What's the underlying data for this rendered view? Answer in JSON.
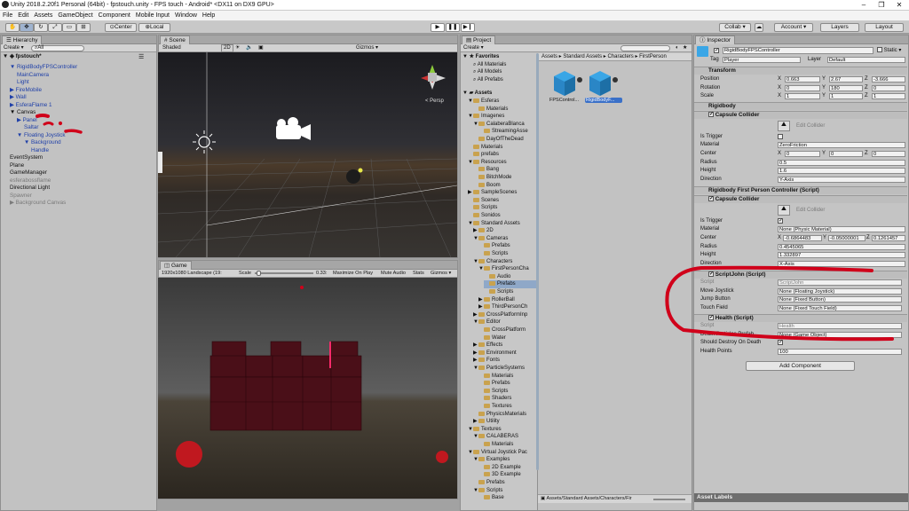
{
  "titlebar": {
    "title": "Unity 2018.2.20f1 Personal (64bit) - fpstouch.unity - FPS touch - Android* <DX11 on DX9 GPU>",
    "minimize": "–",
    "maximize": "❐",
    "close": "✕"
  },
  "menu": [
    "File",
    "Edit",
    "Assets",
    "GameObject",
    "Component",
    "Mobile Input",
    "Window",
    "Help"
  ],
  "toolbar": {
    "pivot": "Center",
    "space": "Local",
    "collab": "Collab ▾",
    "account": "Account ▾",
    "layers": "Layers",
    "layout": "Layout"
  },
  "hierarchy": {
    "tab": "Hierarchy",
    "create": "Create ▾",
    "search": "All",
    "scene": "fpstouch*",
    "items": [
      {
        "label": "RigidBodyFPSController",
        "indent": 1,
        "color": "blue",
        "arrow": "▼"
      },
      {
        "label": "MainCamera",
        "indent": 2,
        "color": "blue",
        "arrow": ""
      },
      {
        "label": "Light",
        "indent": 2,
        "color": "blue",
        "arrow": ""
      },
      {
        "label": "FireMobile",
        "indent": 1,
        "color": "blue",
        "arrow": "▶"
      },
      {
        "label": "Wall",
        "indent": 1,
        "color": "blue",
        "arrow": "▶"
      },
      {
        "label": "EsferaFlame 1",
        "indent": 1,
        "color": "blue",
        "arrow": "▶"
      },
      {
        "label": "Canvas",
        "indent": 1,
        "color": "black",
        "arrow": "▼"
      },
      {
        "label": "Panel",
        "indent": 2,
        "color": "blue",
        "arrow": "▶"
      },
      {
        "label": "Saltar",
        "indent": 3,
        "color": "blue",
        "arrow": ""
      },
      {
        "label": "Floating Joystick",
        "indent": 2,
        "color": "blue",
        "arrow": "▼"
      },
      {
        "label": "Background",
        "indent": 3,
        "color": "blue",
        "arrow": "▼"
      },
      {
        "label": "Handle",
        "indent": 4,
        "color": "blue",
        "arrow": ""
      },
      {
        "label": "EventSystem",
        "indent": 1,
        "color": "black",
        "arrow": ""
      },
      {
        "label": "Plane",
        "indent": 1,
        "color": "black",
        "arrow": ""
      },
      {
        "label": "GameManager",
        "indent": 1,
        "color": "black",
        "arrow": ""
      },
      {
        "label": "esferabossflame",
        "indent": 1,
        "color": "gray",
        "arrow": ""
      },
      {
        "label": "Directional Light",
        "indent": 1,
        "color": "black",
        "arrow": ""
      },
      {
        "label": "Spawner",
        "indent": 1,
        "color": "gray",
        "arrow": ""
      },
      {
        "label": "Background Canvas",
        "indent": 1,
        "color": "gray",
        "arrow": "▶"
      }
    ]
  },
  "scene": {
    "tab": "Scene",
    "shading": "Shaded",
    "mode2d": "2D",
    "gizmos": "Gizmos ▾",
    "persp": "< Persp"
  },
  "game": {
    "tab": "Game",
    "resolution": "1920x1080 Landscape (19:",
    "scale_label": "Scale",
    "scale_value": "0.33:",
    "maximize": "Maximize On Play",
    "mute": "Mute Audio",
    "stats": "Stats",
    "gizmos": "Gizmos ▾"
  },
  "project": {
    "tab": "Project",
    "create": "Create ▾",
    "breadcrumb": [
      "Assets",
      "Standard Assets",
      "Characters",
      "FirstPerson"
    ],
    "favorites": {
      "title": "Favorites",
      "items": [
        "All Materials",
        "All Models",
        "All Prefabs"
      ]
    },
    "assets_title": "Assets",
    "tree": [
      {
        "label": "Esferas",
        "indent": 1,
        "arrow": "▼"
      },
      {
        "label": "Materials",
        "indent": 2,
        "arrow": ""
      },
      {
        "label": "Imagenes",
        "indent": 1,
        "arrow": "▼"
      },
      {
        "label": "CalaberaBlanca",
        "indent": 2,
        "arrow": "▼"
      },
      {
        "label": "StreamingAsse",
        "indent": 3,
        "arrow": ""
      },
      {
        "label": "DayOfTheDead",
        "indent": 2,
        "arrow": ""
      },
      {
        "label": "Materials",
        "indent": 1,
        "arrow": ""
      },
      {
        "label": "prefabs",
        "indent": 1,
        "arrow": ""
      },
      {
        "label": "Resources",
        "indent": 1,
        "arrow": "▼"
      },
      {
        "label": "Bang",
        "indent": 2,
        "arrow": ""
      },
      {
        "label": "BitchMode",
        "indent": 2,
        "arrow": ""
      },
      {
        "label": "Boom",
        "indent": 2,
        "arrow": ""
      },
      {
        "label": "SampleScenes",
        "indent": 1,
        "arrow": "▶"
      },
      {
        "label": "Scenes",
        "indent": 1,
        "arrow": ""
      },
      {
        "label": "Scripts",
        "indent": 1,
        "arrow": ""
      },
      {
        "label": "Sonidos",
        "indent": 1,
        "arrow": ""
      },
      {
        "label": "Standard Assets",
        "indent": 1,
        "arrow": "▼"
      },
      {
        "label": "2D",
        "indent": 2,
        "arrow": "▶"
      },
      {
        "label": "Cameras",
        "indent": 2,
        "arrow": "▼"
      },
      {
        "label": "Prefabs",
        "indent": 3,
        "arrow": ""
      },
      {
        "label": "Scripts",
        "indent": 3,
        "arrow": ""
      },
      {
        "label": "Characters",
        "indent": 2,
        "arrow": "▼"
      },
      {
        "label": "FirstPersonCha",
        "indent": 3,
        "arrow": "▼"
      },
      {
        "label": "Audio",
        "indent": 4,
        "arrow": ""
      },
      {
        "label": "Prefabs",
        "indent": 4,
        "arrow": "",
        "selected": true
      },
      {
        "label": "Scripts",
        "indent": 4,
        "arrow": ""
      },
      {
        "label": "RollerBall",
        "indent": 3,
        "arrow": "▶"
      },
      {
        "label": "ThirdPersonCh",
        "indent": 3,
        "arrow": "▶"
      },
      {
        "label": "CrossPlatformInp",
        "indent": 2,
        "arrow": "▶"
      },
      {
        "label": "Editor",
        "indent": 2,
        "arrow": "▼"
      },
      {
        "label": "CrossPlatform",
        "indent": 3,
        "arrow": ""
      },
      {
        "label": "Water",
        "indent": 3,
        "arrow": ""
      },
      {
        "label": "Effects",
        "indent": 2,
        "arrow": "▶"
      },
      {
        "label": "Environment",
        "indent": 2,
        "arrow": "▶"
      },
      {
        "label": "Fonts",
        "indent": 2,
        "arrow": "▶"
      },
      {
        "label": "ParticleSystems",
        "indent": 2,
        "arrow": "▼"
      },
      {
        "label": "Materials",
        "indent": 3,
        "arrow": ""
      },
      {
        "label": "Prefabs",
        "indent": 3,
        "arrow": ""
      },
      {
        "label": "Scripts",
        "indent": 3,
        "arrow": ""
      },
      {
        "label": "Shaders",
        "indent": 3,
        "arrow": ""
      },
      {
        "label": "Textures",
        "indent": 3,
        "arrow": ""
      },
      {
        "label": "PhysicsMaterials",
        "indent": 2,
        "arrow": ""
      },
      {
        "label": "Utility",
        "indent": 2,
        "arrow": "▶"
      },
      {
        "label": "Textures",
        "indent": 1,
        "arrow": "▼"
      },
      {
        "label": "CALABERAS",
        "indent": 2,
        "arrow": "▼"
      },
      {
        "label": "Materials",
        "indent": 3,
        "arrow": ""
      },
      {
        "label": "Virtual Joystick Pac",
        "indent": 1,
        "arrow": "▼"
      },
      {
        "label": "Examples",
        "indent": 2,
        "arrow": "▼"
      },
      {
        "label": "2D Example",
        "indent": 3,
        "arrow": ""
      },
      {
        "label": "3D Example",
        "indent": 3,
        "arrow": ""
      },
      {
        "label": "Prefabs",
        "indent": 2,
        "arrow": ""
      },
      {
        "label": "Scripts",
        "indent": 2,
        "arrow": "▼"
      },
      {
        "label": "Base",
        "indent": 3,
        "arrow": ""
      }
    ],
    "assets_grid": [
      {
        "label": "FPSControl...",
        "selected": false
      },
      {
        "label": "RigidBodyF...",
        "selected": true
      }
    ],
    "footer_path": "Assets/Standard Assets/Characters/Fir"
  },
  "inspector": {
    "tab": "Inspector",
    "object_name": "RigidBodyFPSController",
    "static_label": "Static",
    "tag_label": "Tag",
    "tag_value": "Player",
    "layer_label": "Layer",
    "layer_value": "Default",
    "transform": {
      "title": "Transform",
      "rows": [
        {
          "label": "Position",
          "x": "0.663",
          "y": "2.67",
          "z": "-3.666"
        },
        {
          "label": "Rotation",
          "x": "0",
          "y": "180",
          "z": "0"
        },
        {
          "label": "Scale",
          "x": "1",
          "y": "1",
          "z": "1"
        }
      ]
    },
    "rigidbody_title": "Rigidbody",
    "capsule1": {
      "title": "Capsule Collider",
      "edit": "Edit Collider",
      "is_trigger": "Is Trigger",
      "material_label": "Material",
      "material_value": "ZeroFriction",
      "center_label": "Center",
      "center": {
        "x": "0",
        "y": "0",
        "z": "0"
      },
      "radius_label": "Radius",
      "radius": "0.5",
      "height_label": "Height",
      "height": "1.6",
      "direction_label": "Direction",
      "direction": "Y-Axis"
    },
    "rbfpc_title": "Rigidbody First Person Controller (Script)",
    "capsule2": {
      "title": "Capsule Collider",
      "edit": "Edit Collider",
      "is_trigger": "Is Trigger",
      "material_label": "Material",
      "material_value": "None (Physic Material)",
      "center_label": "Center",
      "center": {
        "x": "-0.6864483",
        "y": "-0.05000001",
        "z": "0.1261457"
      },
      "radius_label": "Radius",
      "radius": "0.4545065",
      "height_label": "Height",
      "height": "1.332897",
      "direction_label": "Direction",
      "direction": "X-Axis"
    },
    "scriptjohn": {
      "title": "ScriptJohn (Script)",
      "rows": [
        {
          "label": "Script",
          "value": "ScriptJohn",
          "dim": true
        },
        {
          "label": "Move Joystick",
          "value": "None (Floating Joystick)",
          "dim": false
        },
        {
          "label": "Jump Button",
          "value": "None (Fixed Button)",
          "dim": false
        },
        {
          "label": "Touch Field",
          "value": "None (Fixed Touch Field)",
          "dim": false
        }
      ]
    },
    "health": {
      "title": "Health (Script)",
      "rows": [
        {
          "label": "Script",
          "value": "Health",
          "dim": true
        },
        {
          "label": "Death Particles Prefab",
          "value": "None (Game Object)",
          "dim": false
        },
        {
          "label": "Should Destroy On Death",
          "value": "",
          "dim": false
        },
        {
          "label": "Health Points",
          "value": "100",
          "dim": false
        }
      ]
    },
    "add_component": "Add Component",
    "footer": "Asset Labels"
  },
  "colors": {
    "annotation_red": "#d0001a",
    "unity_blue": "#1e3fa8",
    "selection": "#8fa8c8",
    "asset_cube": "#3aa6e6"
  }
}
